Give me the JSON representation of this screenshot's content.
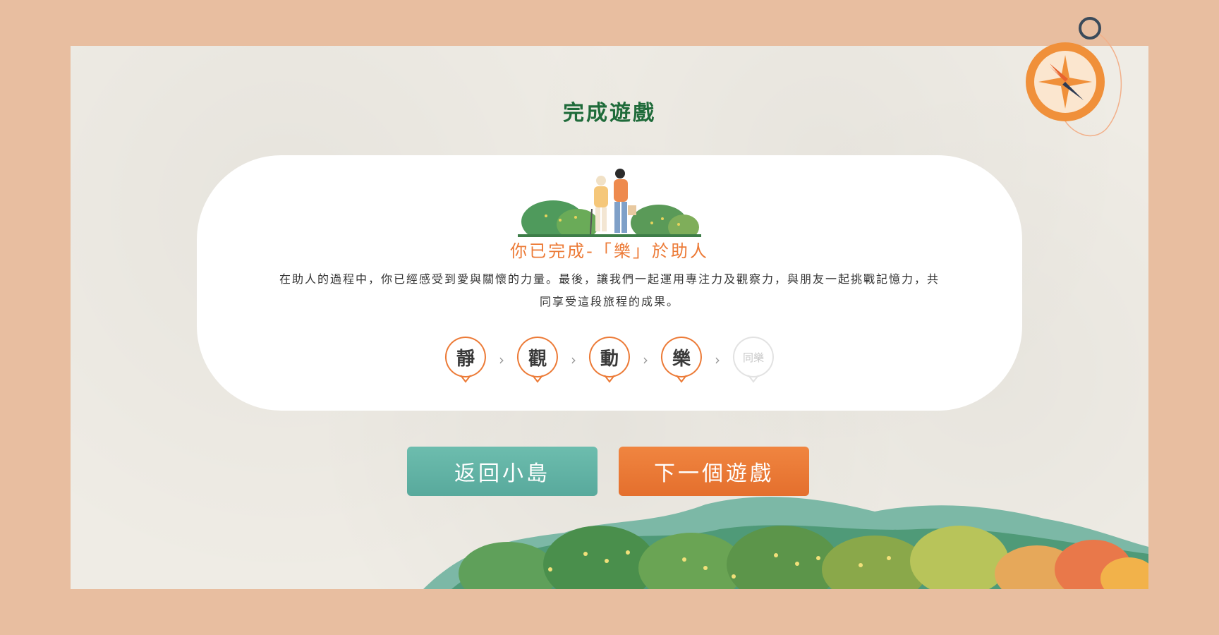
{
  "page": {
    "title": "完成遊戲"
  },
  "card": {
    "title": "你已完成-「樂」於助人",
    "description": "在助人的過程中，你已經感受到愛與關懷的力量。最後，讓我們一起運用專注力及觀察力，與朋友一起挑戰記憶力，共同享受這段旅程的成果。"
  },
  "progress": {
    "steps": [
      {
        "label": "靜",
        "state": "completed"
      },
      {
        "label": "觀",
        "state": "completed"
      },
      {
        "label": "動",
        "state": "completed"
      },
      {
        "label": "樂",
        "state": "completed"
      },
      {
        "label": "同樂",
        "state": "locked"
      }
    ],
    "separator": "›"
  },
  "buttons": {
    "back_label": "返回小島",
    "next_label": "下一個遊戲"
  },
  "colors": {
    "background": "#e8bea0",
    "paper": "#efece5",
    "title_green": "#1f6b3a",
    "accent_orange": "#ec7a36",
    "button_teal": "#63b4a6",
    "button_orange": "#ec7a36"
  },
  "icons": {
    "compass": "compass-icon",
    "illustration": "elderly-helper-illustration",
    "hills": "hills-decoration"
  }
}
